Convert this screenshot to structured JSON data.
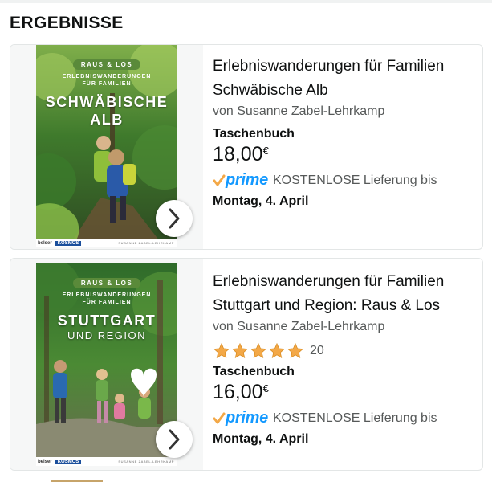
{
  "page": {
    "heading": "ERGEBNISSE"
  },
  "results": [
    {
      "title_line1": "Erlebniswanderungen für Familien",
      "title_line2": "Schwäbische Alb",
      "author": "von Susanne Zabel-Lehrkamp",
      "format": "Taschenbuch",
      "price_value": "18,00",
      "price_currency": "€",
      "prime_label": "prime",
      "delivery_text": "KOSTENLOSE Lieferung bis",
      "delivery_date": "Montag, 4. April",
      "cover": {
        "series": "RAUS & LOS",
        "subtitle_line1": "ERLEBNISWANDERUNGEN",
        "subtitle_line2": "FÜR FAMILIEN",
        "title_line1": "SCHWÄBISCHE",
        "title_line2": "ALB",
        "publisher1": "belser",
        "publisher2": "KOSMOS",
        "author": "SUSANNE ZABEL-LEHRKAMP"
      }
    },
    {
      "title_line1": "Erlebniswanderungen für Familien",
      "title_line2": "Stuttgart und Region: Raus & Los",
      "author": "von Susanne Zabel-Lehrkamp",
      "rating_stars": 5,
      "rating_count": "20",
      "format": "Taschenbuch",
      "price_value": "16,00",
      "price_currency": "€",
      "prime_label": "prime",
      "delivery_text": "KOSTENLOSE Lieferung bis",
      "delivery_date": "Montag, 4. April",
      "cover": {
        "series": "RAUS & LOS",
        "subtitle_line1": "ERLEBNISWANDERUNGEN",
        "subtitle_line2": "FÜR FAMILIEN",
        "title_line1": "STUTTGART",
        "title_line2": "UND REGION",
        "publisher1": "belser",
        "publisher2": "KOSMOS",
        "author": "SUSANNE ZABEL-LEHRKAMP"
      }
    }
  ],
  "colors": {
    "prime_blue": "#1399ff",
    "star_orange": "#f3a847",
    "prime_check": "#f3a847"
  },
  "icons": {
    "next": "chevron-right-icon",
    "prime": "prime-check-icon",
    "star": "star-icon",
    "heart": "heart-icon"
  }
}
